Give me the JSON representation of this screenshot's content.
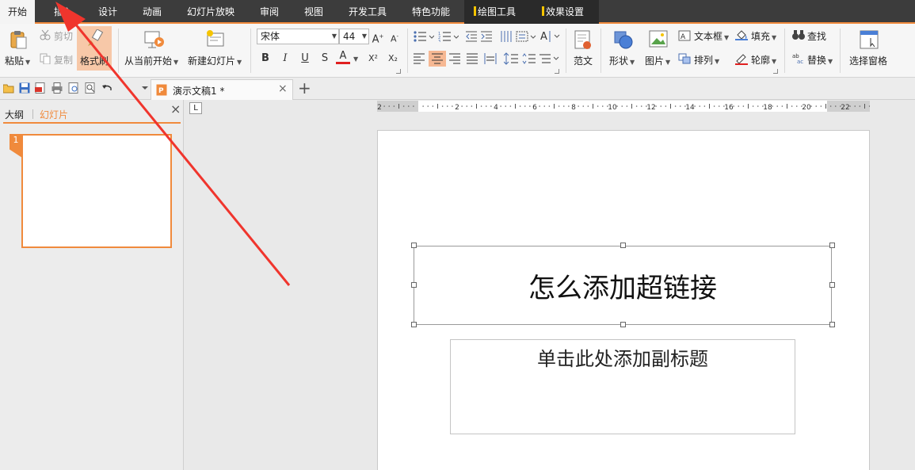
{
  "menu_tabs": [
    {
      "label": "开始"
    },
    {
      "label": "插入"
    },
    {
      "label": "设计"
    },
    {
      "label": "动画"
    },
    {
      "label": "幻灯片放映"
    },
    {
      "label": "审阅"
    },
    {
      "label": "视图"
    },
    {
      "label": "开发工具"
    },
    {
      "label": "特色功能"
    }
  ],
  "context_tabs": [
    {
      "label": "绘图工具"
    },
    {
      "label": "效果设置"
    }
  ],
  "ribbon": {
    "paste": "粘贴",
    "cut": "剪切",
    "copy": "复制",
    "format_painter": "格式刷",
    "from_current": "从当前开始",
    "new_slide": "新建幻灯片",
    "font_name": "宋体",
    "font_size": "44",
    "bold": "B",
    "italic": "I",
    "underline": "U",
    "strike": "S",
    "font_color": "A",
    "superscript": "X²",
    "subscript": "X₂",
    "template": "范文",
    "shape": "形状",
    "picture": "图片",
    "textbox": "文本框",
    "arrange": "排列",
    "fill": "填充",
    "outline": "轮廓",
    "find": "查找",
    "replace": "替换",
    "select_pane": "选择窗格"
  },
  "doc_tab": {
    "title": "演示文稿1 *"
  },
  "pane": {
    "outline": "大纲",
    "slides": "幻灯片",
    "slide_number": "1"
  },
  "slide": {
    "title": "怎么添加超链接",
    "subtitle_placeholder": "单击此处添加副标题"
  },
  "colors": {
    "accent": "#f08a3c",
    "menubar": "#3c3c3c",
    "arrow": "#f0352d"
  }
}
